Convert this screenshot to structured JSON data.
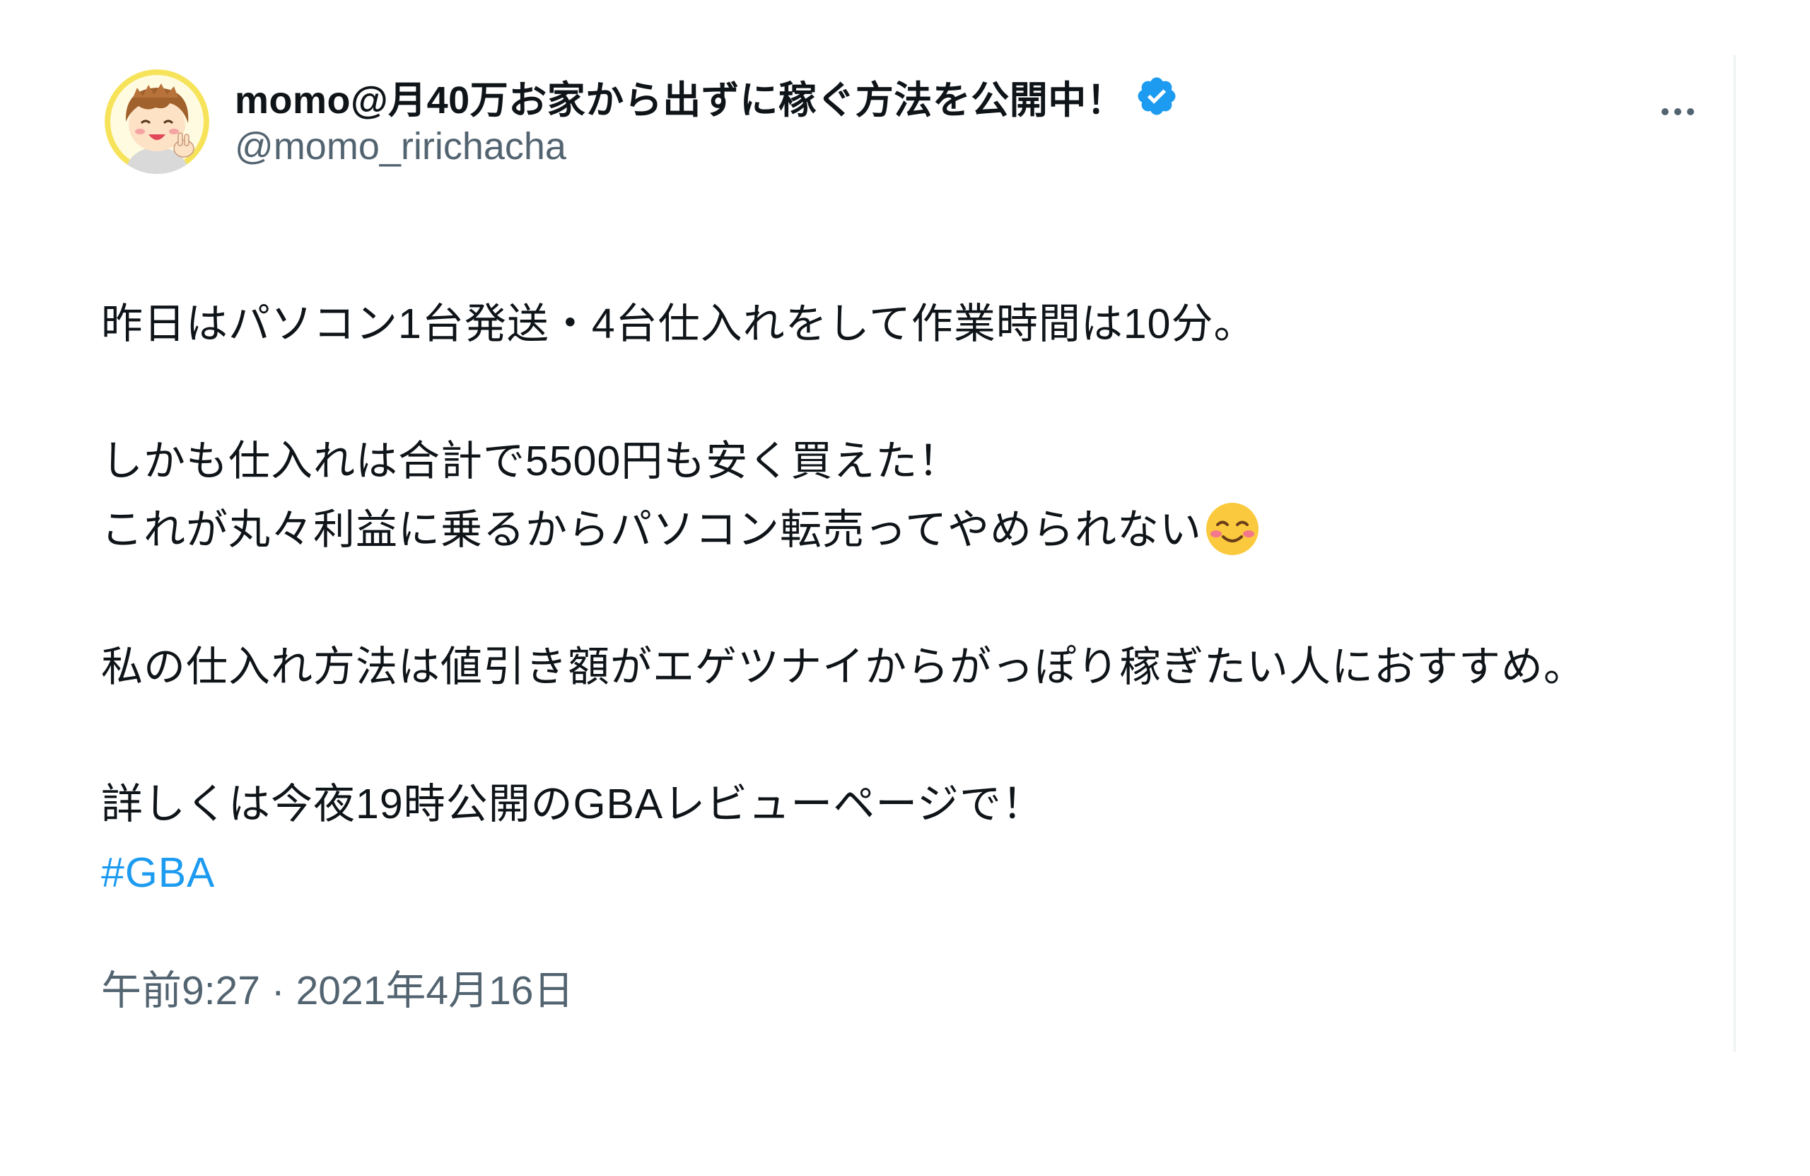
{
  "tweet": {
    "author": {
      "display_name": "momo@月40万お家から出ずに稼ぐ方法を公開中！",
      "handle": "@momo_ririchacha",
      "verified": true
    },
    "body": {
      "line1": "昨日はパソコン1台発送・4台仕入れをして作業時間は10分。",
      "line2": "しかも仕入れは合計で5500円も安く買えた！",
      "line3": "これが丸々利益に乗るからパソコン転売ってやめられない",
      "line3_emoji": "smiling-face-emoji",
      "line4": "私の仕入れ方法は値引き額がエゲツナイからがっぽり稼ぎたい人におすすめ。",
      "line5": "詳しくは今夜19時公開のGBAレビューページで！",
      "hashtag": "#GBA"
    },
    "timestamp": "午前9:27 · 2021年4月16日",
    "icons": {
      "verified": "verified-badge-icon",
      "more": "more-options-icon"
    },
    "colors": {
      "link": "#1d9bf0",
      "verified": "#1d9bf0",
      "secondary_text": "#536471"
    }
  }
}
